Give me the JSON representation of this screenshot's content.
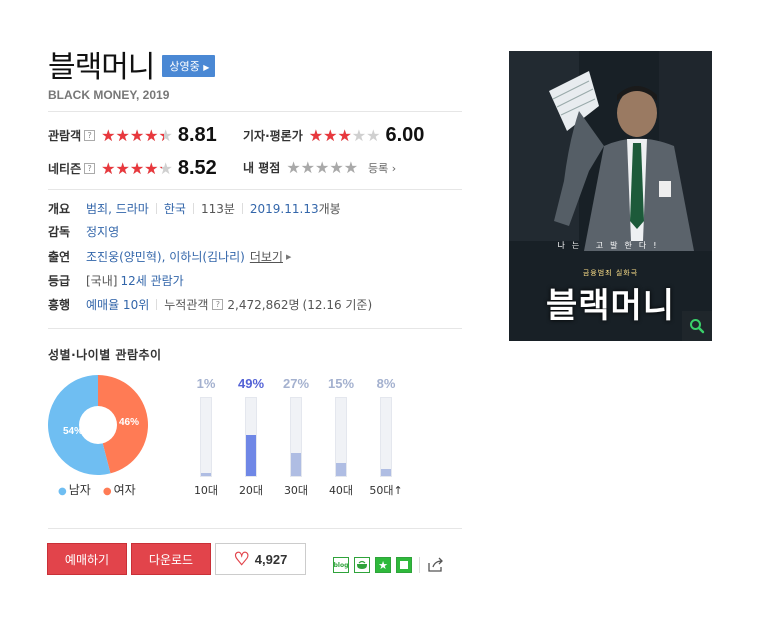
{
  "movie": {
    "title": "블랙머니",
    "status_badge": "상영중",
    "english_title": "BLACK MONEY, 2019"
  },
  "ratings": {
    "audience": {
      "label": "관람객",
      "score": "8.81",
      "fraction": 0.881
    },
    "critics": {
      "label": "기자·평론가",
      "score": "6.00",
      "fraction": 0.6
    },
    "netizen": {
      "label": "네티즌",
      "score": "8.52",
      "fraction": 0.852
    },
    "my_rating": {
      "label": "내 평점",
      "action": "등록"
    },
    "help_glyph": "?"
  },
  "info": {
    "overview": {
      "label": "개요",
      "genre": "범죄, 드라마",
      "country": "한국",
      "runtime": "113분",
      "release_date": "2019.11.13",
      "release_suffix": "개봉"
    },
    "director": {
      "label": "감독",
      "name": "정지영"
    },
    "cast": {
      "label": "출연",
      "names": "조진웅(양민혁), 이하늬(김나리)",
      "more": "더보기"
    },
    "grade": {
      "label": "등급",
      "prefix": "[국내]",
      "value": "12세 관람가"
    },
    "box_office": {
      "label": "흥행",
      "rank": "예매율 10위",
      "cumulative_label": "누적관객",
      "cumulative_value": "2,472,862명",
      "cumulative_date": "(12.16 기준)"
    }
  },
  "audience_chart": {
    "title": "성별·나이별 관람추이",
    "gender": [
      {
        "name": "남자",
        "percent": 54,
        "label": "54%",
        "color": "#6fbef2"
      },
      {
        "name": "여자",
        "percent": 46,
        "label": "46%",
        "color": "#ff7b55"
      }
    ]
  },
  "chart_data": {
    "type": "bar",
    "title": "",
    "categories": [
      "10대",
      "20대",
      "30대",
      "40대",
      "50대↑"
    ],
    "values": [
      1,
      49,
      27,
      15,
      8
    ],
    "value_labels": [
      "1%",
      "49%",
      "27%",
      "15%",
      "8%"
    ],
    "highlight_index": 1,
    "ylim": [
      0,
      100
    ],
    "colors": {
      "normal": "#afbde3",
      "highlight": "#6f87e6"
    }
  },
  "actions": {
    "reserve": "예매하기",
    "download": "다운로드",
    "like_count": "4,927"
  },
  "share": {
    "blog": "blog"
  },
  "poster": {
    "title": "블랙머니",
    "tagline": "나는 고발한다!",
    "credit": "금융범죄 실화극"
  },
  "colors": {
    "accent_red": "#e2444b",
    "link_blue": "#3366aa",
    "badge_blue": "#4a88d4",
    "share_green": "#2fb93b"
  }
}
